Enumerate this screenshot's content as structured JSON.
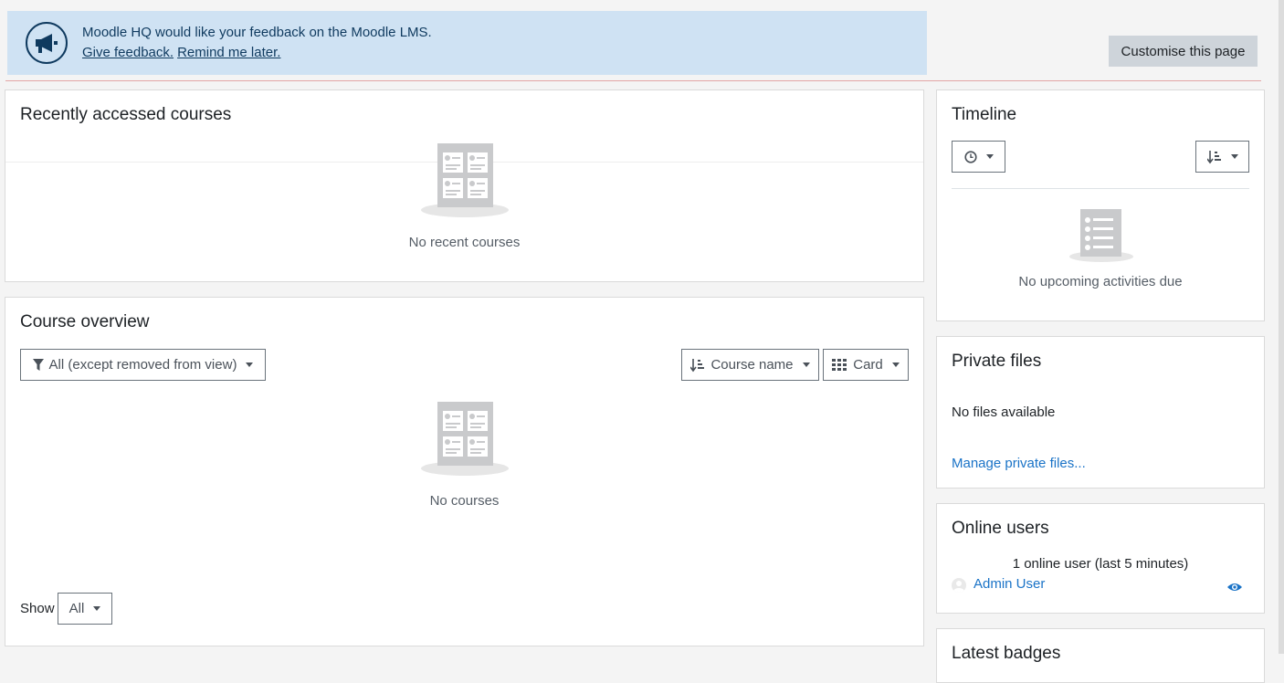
{
  "banner": {
    "message": "Moodle HQ would like your feedback on the Moodle LMS.",
    "give_feedback": "Give feedback.",
    "remind_later": "Remind me later.",
    "icon": "megaphone-icon"
  },
  "header": {
    "customise_label": "Customise this page"
  },
  "recent_courses": {
    "title": "Recently accessed courses",
    "empty": "No recent courses"
  },
  "course_overview": {
    "title": "Course overview",
    "filter_label": "All (except removed from view)",
    "sort_label": "Course name",
    "view_label": "Card",
    "empty": "No courses",
    "show_label": "Show",
    "show_value": "All"
  },
  "timeline": {
    "title": "Timeline",
    "empty": "No upcoming activities due"
  },
  "private_files": {
    "title": "Private files",
    "empty": "No files available",
    "manage_link": "Manage private files..."
  },
  "online_users": {
    "title": "Online users",
    "summary": "1 online user (last 5 minutes)",
    "user_name": "Admin User"
  },
  "latest_badges": {
    "title": "Latest badges"
  },
  "colors": {
    "banner_bg": "#cfe2f3",
    "link": "#1a73c7",
    "accent_red": "#e3a6a6"
  }
}
